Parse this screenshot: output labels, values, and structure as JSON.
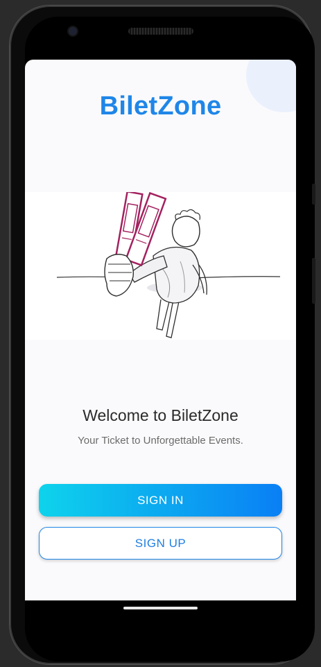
{
  "app": {
    "brand": "BiletZone",
    "welcome_title": "Welcome to BiletZone",
    "tagline": "Your Ticket to Unforgettable Events."
  },
  "buttons": {
    "sign_in_label": "SIGN IN",
    "sign_up_label": "SIGN UP"
  },
  "illustration": {
    "subject": "person-holding-tickets-illustration"
  },
  "colors": {
    "brand_blue": "#1f86e8",
    "gradient_start": "#0ed3ec",
    "gradient_end": "#0a7ff5",
    "ticket_magenta": "#a3215f"
  },
  "icons": {
    "camera": "front-camera-icon",
    "speaker": "earpiece-speaker-icon"
  }
}
